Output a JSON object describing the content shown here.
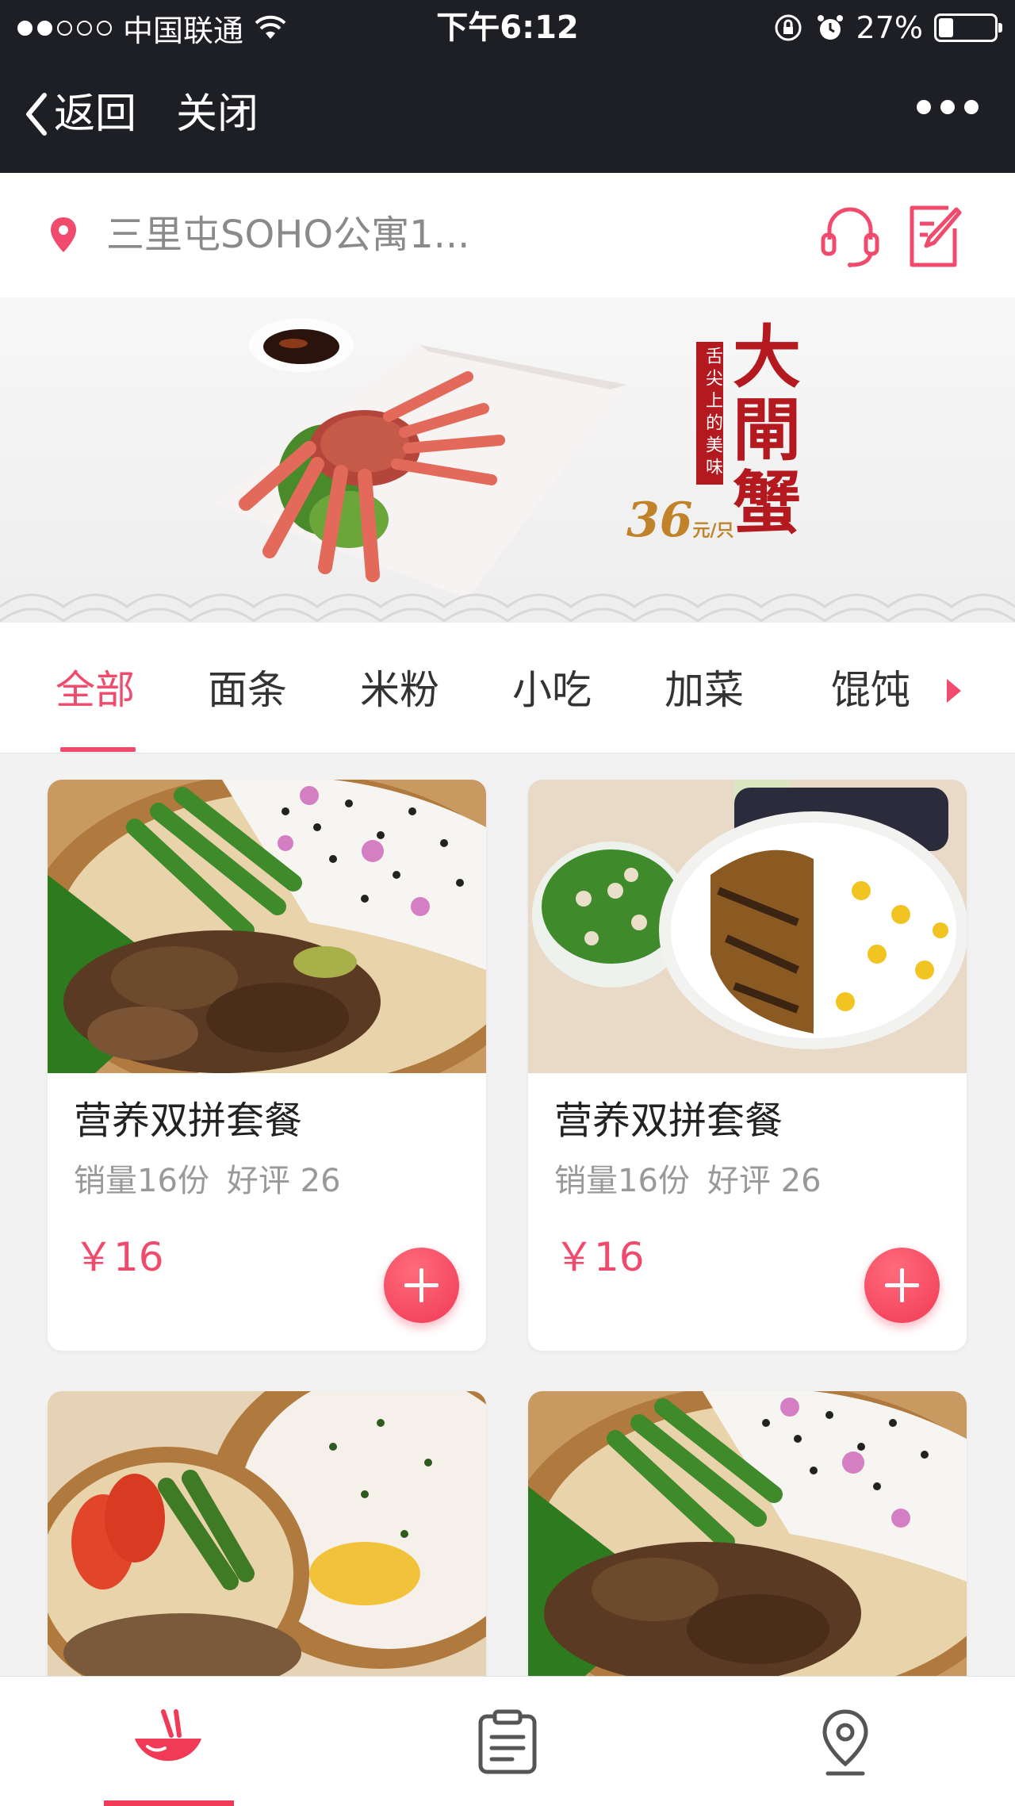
{
  "status_bar": {
    "carrier": "中国联通",
    "time": "下午6:12",
    "battery": "27%",
    "battery_level": 0.27
  },
  "nav": {
    "back_label": "返回",
    "close_label": "关闭"
  },
  "address": {
    "text": "三里屯SOHO公寓1..."
  },
  "banner": {
    "tagline": "舌尖上的美味",
    "title": "大閘蟹",
    "price": "36",
    "price_unit": "元/只"
  },
  "tabs": [
    {
      "label": "全部",
      "active": true
    },
    {
      "label": "面条"
    },
    {
      "label": "米粉"
    },
    {
      "label": "小吃"
    },
    {
      "label": "加菜"
    },
    {
      "label": "馄饨"
    }
  ],
  "products": [
    {
      "name": "营养双拼套餐",
      "sales": "销量16份",
      "rating": "好评 26",
      "price": "￥16"
    },
    {
      "name": "营养双拼套餐",
      "sales": "销量16份",
      "rating": "好评 26",
      "price": "￥16"
    }
  ],
  "colors": {
    "accent": "#f04a6c",
    "topbar": "#1e1f25"
  },
  "bottom_nav": [
    {
      "icon": "bowl-icon",
      "active": true
    },
    {
      "icon": "order-list-icon"
    },
    {
      "icon": "location-icon"
    }
  ]
}
